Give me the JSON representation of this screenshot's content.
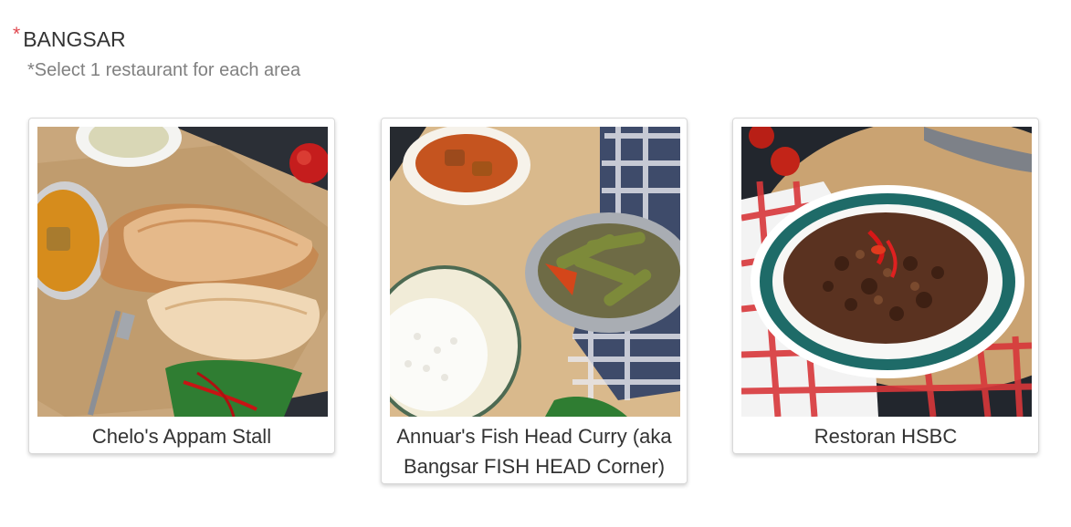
{
  "question": {
    "required_marker": "*",
    "title": "BANGSAR",
    "hint": "*Select 1 restaurant for each area"
  },
  "options": [
    {
      "label": "Chelo's Appam Stall",
      "image": "appam-dosa-photo"
    },
    {
      "label": "Annuar's Fish Head Curry (aka Bangsar FISH HEAD Corner)",
      "image": "fish-head-curry-photo"
    },
    {
      "label": "Restoran HSBC",
      "image": "fried-rice-photo"
    }
  ]
}
